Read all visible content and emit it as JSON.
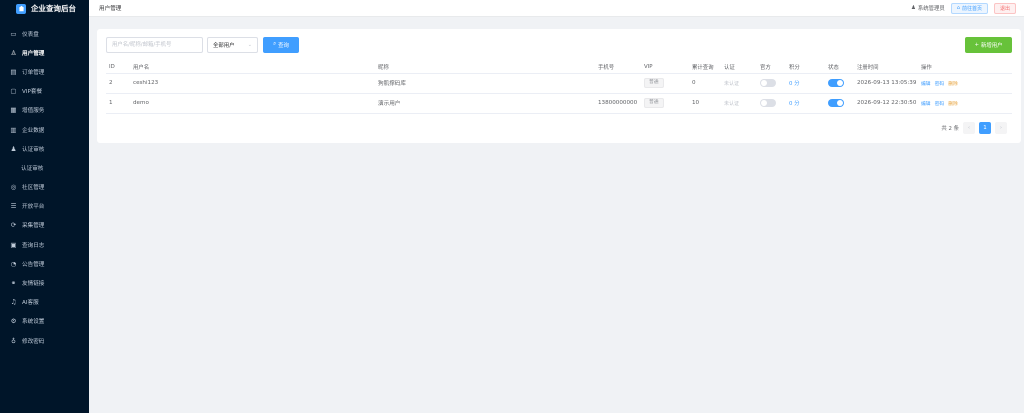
{
  "app": {
    "title": "企业查询后台"
  },
  "sidebar": {
    "items": [
      {
        "label": "仪表盘",
        "icon": "dashboard-icon",
        "glyph": "▭"
      },
      {
        "label": "用户管理",
        "icon": "user-icon",
        "glyph": "♙"
      },
      {
        "label": "订单管理",
        "icon": "order-icon",
        "glyph": "▤"
      },
      {
        "label": "VIP套餐",
        "icon": "vip-icon",
        "glyph": "▢"
      },
      {
        "label": "增值服务",
        "icon": "service-icon",
        "glyph": "▦"
      },
      {
        "label": "企业数据",
        "icon": "data-icon",
        "glyph": "▥"
      },
      {
        "label": "认证审核",
        "icon": "verify-icon",
        "glyph": "♟"
      },
      {
        "label": "认证审核",
        "icon": "",
        "glyph": ""
      },
      {
        "label": "社区管理",
        "icon": "community-icon",
        "glyph": "◎"
      },
      {
        "label": "开放平台",
        "icon": "platform-icon",
        "glyph": "☰"
      },
      {
        "label": "采集管理",
        "icon": "collect-icon",
        "glyph": "⟳"
      },
      {
        "label": "查询日志",
        "icon": "log-icon",
        "glyph": "▣"
      },
      {
        "label": "公告管理",
        "icon": "notice-icon",
        "glyph": "◔"
      },
      {
        "label": "友情链接",
        "icon": "link-icon",
        "glyph": "⚭"
      },
      {
        "label": "AI客服",
        "icon": "headset-icon",
        "glyph": "♫"
      },
      {
        "label": "系统设置",
        "icon": "gear-icon",
        "glyph": "⚙"
      },
      {
        "label": "修改密码",
        "icon": "key-icon",
        "glyph": "♁"
      }
    ],
    "active_index": 1
  },
  "header": {
    "breadcrumb": "用户管理",
    "admin_label": "系统管理员",
    "home_button": "前往首页",
    "logout_button": "退出"
  },
  "toolbar": {
    "search_placeholder": "用户名/昵称/邮箱/手机号",
    "filter_value": "全部用户",
    "query_button": "查询",
    "add_button": "新增用户"
  },
  "table": {
    "columns": [
      "ID",
      "用户名",
      "昵称",
      "手机号",
      "VIP",
      "累计查询",
      "认证",
      "官方",
      "积分",
      "状态",
      "注册时间",
      "操作"
    ],
    "rows": [
      {
        "id": "2",
        "username": "ceshi123",
        "nickname": "狗肌撑码库",
        "phone": "",
        "vip": "普通",
        "queries": "0",
        "verify": "未认证",
        "official": false,
        "points": "0 分",
        "status": true,
        "registered": "2026-09-13 13:05:39"
      },
      {
        "id": "1",
        "username": "demo",
        "nickname": "演示用户",
        "phone": "13800000000",
        "vip": "普通",
        "queries": "10",
        "verify": "未认证",
        "official": false,
        "points": "0 分",
        "status": true,
        "registered": "2026-09-12 22:30:50"
      }
    ],
    "actions": {
      "edit": "编辑",
      "password": "密码",
      "delete": "删除"
    }
  },
  "pagination": {
    "total_text": "共 2 条",
    "prev": "‹",
    "current": "1",
    "next": "›"
  },
  "colors": {
    "sidebar_bg": "#001529",
    "primary": "#409eff",
    "success": "#67c23a",
    "danger": "#f56c6c",
    "warning": "#e6a23c"
  }
}
